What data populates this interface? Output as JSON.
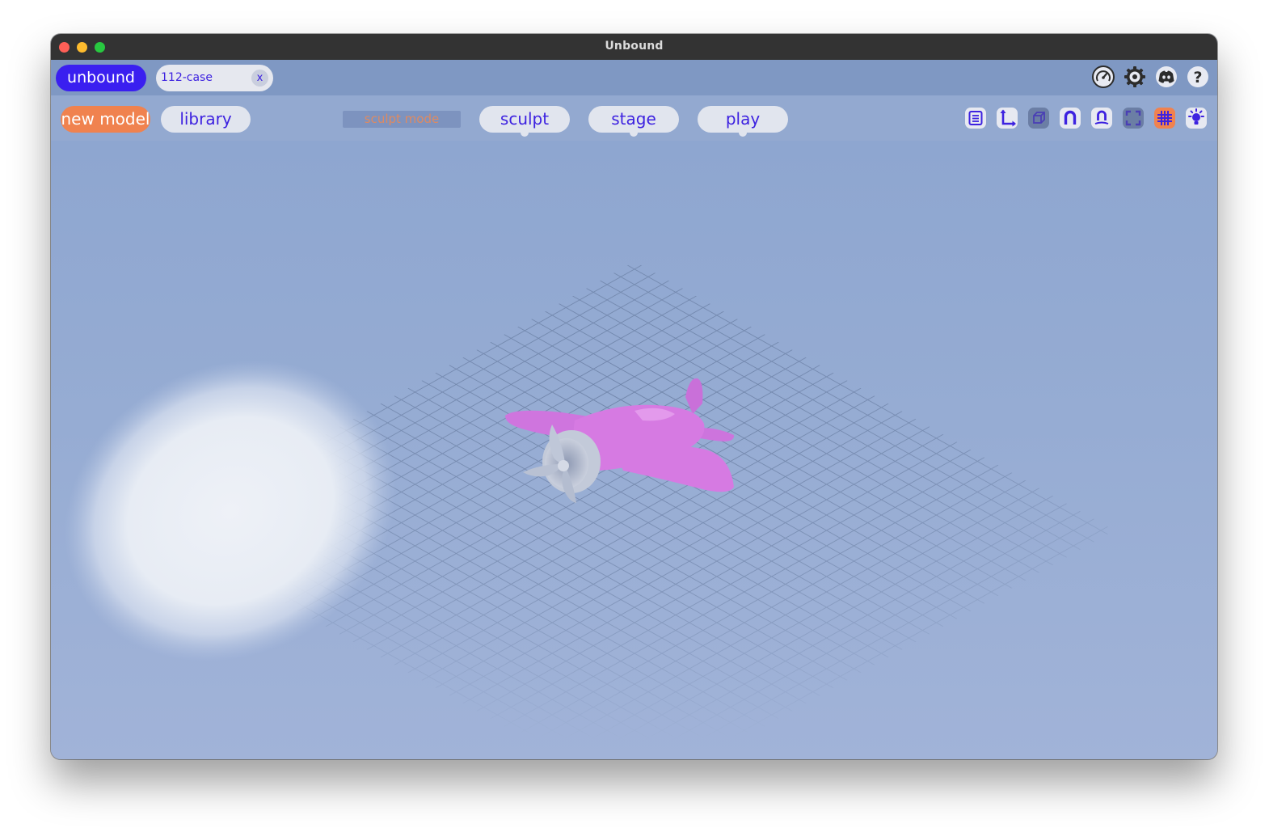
{
  "window": {
    "title": "Unbound"
  },
  "topbar": {
    "brand": "unbound",
    "document_tab": {
      "name": "112-case",
      "close_label": "x"
    },
    "icons": [
      "speedometer-icon",
      "settings-gear-icon",
      "discord-icon",
      "help-icon"
    ]
  },
  "toolbar": {
    "new_model": "new model",
    "library": "library",
    "mode_label": "sculpt mode",
    "modes": [
      "sculpt",
      "stage",
      "play"
    ],
    "view_icons": [
      "outline-list-icon",
      "axes-icon",
      "cube-icon",
      "magnet-icon",
      "mirror-magnet-icon",
      "frame-icon",
      "grid-icon",
      "light-icon"
    ]
  },
  "colors": {
    "accent": "#3a1ff0",
    "new_model": "#f0824f",
    "background": "#93a9d0",
    "model": "#d67ae2"
  }
}
